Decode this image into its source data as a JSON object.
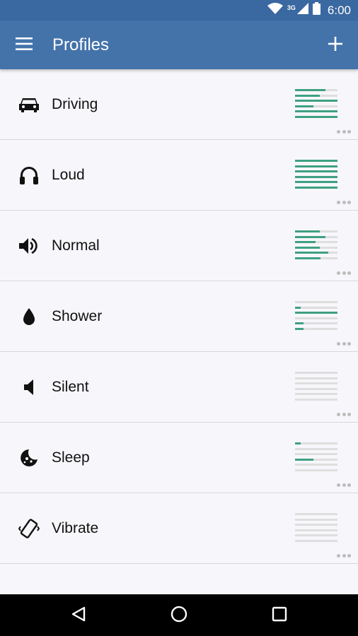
{
  "status_bar": {
    "network_label": "3G",
    "time": "6:00",
    "icons": [
      "wifi-icon",
      "cell-signal-icon",
      "battery-icon"
    ]
  },
  "app_bar": {
    "title": "Profiles",
    "menu_icon": "menu-icon",
    "add_icon": "add-icon",
    "color": "#4473aa"
  },
  "colors": {
    "level_fill": "#3fa080",
    "level_track": "#dedede"
  },
  "profiles": [
    {
      "label": "Driving",
      "icon": "car-icon",
      "levels": [
        0.72,
        0.58,
        1.0,
        0.44,
        1.0,
        1.0
      ]
    },
    {
      "label": "Loud",
      "icon": "headphones-icon",
      "levels": [
        1.0,
        1.0,
        1.0,
        1.0,
        1.0,
        1.0
      ]
    },
    {
      "label": "Normal",
      "icon": "speaker-icon",
      "levels": [
        0.58,
        0.72,
        0.48,
        0.58,
        0.78,
        0.6
      ]
    },
    {
      "label": "Shower",
      "icon": "water-drop-icon",
      "levels": [
        0.0,
        0.14,
        1.0,
        0.0,
        0.2,
        0.2
      ]
    },
    {
      "label": "Silent",
      "icon": "volume-mute-icon",
      "levels": [
        0,
        0,
        0,
        0,
        0,
        0
      ]
    },
    {
      "label": "Sleep",
      "icon": "moon-icon",
      "levels": [
        0.14,
        0.0,
        0.0,
        0.44,
        0.0,
        0.0
      ]
    },
    {
      "label": "Vibrate",
      "icon": "vibrate-icon",
      "levels": [
        0,
        0,
        0,
        0,
        0,
        0
      ]
    }
  ],
  "nav_bar": {
    "icons": [
      "back-icon",
      "home-icon",
      "recents-icon"
    ]
  }
}
